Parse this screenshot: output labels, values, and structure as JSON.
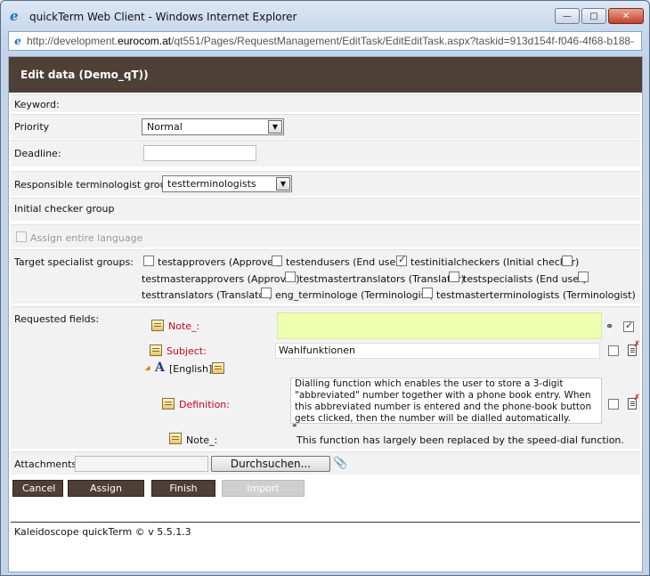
{
  "window": {
    "title": "quickTerm Web Client - Windows Internet Explorer",
    "url_prefix": "http://development.",
    "url_domain": "eurocom.at",
    "url_rest": "/qt551/Pages/RequestManagement/EditTask/EditEditTask.aspx?taskid=913d154f-f046-4f68-b188-"
  },
  "header": {
    "title": "Edit data (Demo_qT))"
  },
  "form": {
    "keyword_label": "Keyword:",
    "priority_label": "Priority",
    "priority_value": "Normal",
    "deadline_label": "Deadline:",
    "deadline_value": "",
    "responsible_label": "Responsible terminologist group:",
    "responsible_value": "testterminologists",
    "initial_checker_label": "Initial checker group",
    "assign_language_label": "Assign entire language",
    "target_groups_label": "Target specialist groups:",
    "target_groups": [
      {
        "label": "testapprovers (Approver)",
        "checked": false
      },
      {
        "label": "testendusers (End user)",
        "checked": false
      },
      {
        "label": "testinitialcheckers (Initial checker)",
        "checked": true
      },
      {
        "label": "testmasterapprovers (Approver)",
        "checked": false
      },
      {
        "label": "testmastertranslators (Translator)",
        "checked": false
      },
      {
        "label": "testspecialists (End user)",
        "checked": false
      },
      {
        "label": "testtranslators (Translator)",
        "checked": false
      },
      {
        "label": "eng_terminologe (Terminologist)",
        "checked": false
      },
      {
        "label": "testmasterterminologists (Terminologist)",
        "checked": false
      }
    ],
    "requested_label": "Requested fields:",
    "fields": {
      "note_label": "Note_:",
      "note_value": "",
      "subject_label": "Subject:",
      "subject_value": "Wahlfunktionen",
      "language_label": "[English]",
      "definition_label": "Definition:",
      "definition_value": "Dialling function which enables the user to store a 3-digit \"abbreviated\" number together with a phone book entry. When this abbreviated number is entered and the phone-book button gets clicked, then the number will be dialled automatically.",
      "note2_label": "Note_:",
      "note2_value": "This function has largely been replaced by the speed-dial function."
    },
    "attachments_label": "Attachments:",
    "browse_label": "Durchsuchen..."
  },
  "buttons": {
    "cancel": "Cancel",
    "assign_rework": "Assign rework",
    "finish_later": "Finish later",
    "import_changes": "Import changes"
  },
  "footer": {
    "text": "Kaleidoscope quickTerm © v 5.5.1.3"
  },
  "colors": {
    "header_bg": "#4e3f37",
    "note_bg": "#efffb0",
    "required_label": "#d0021b"
  }
}
